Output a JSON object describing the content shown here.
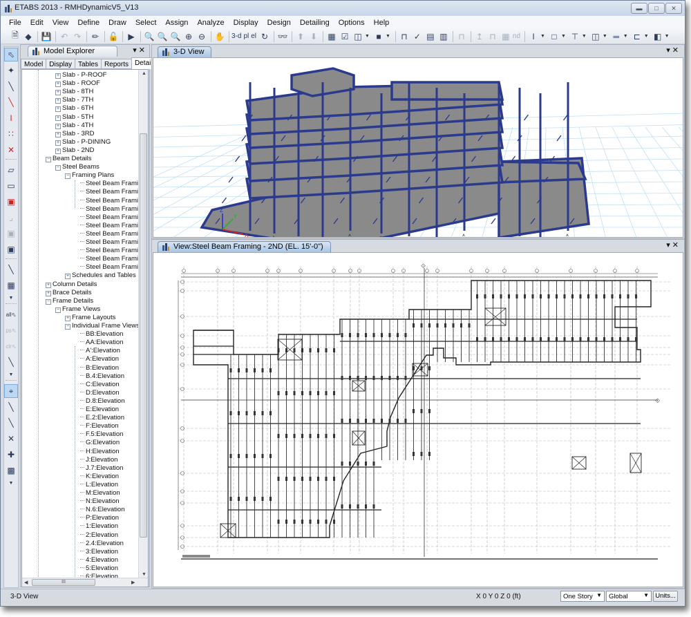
{
  "window": {
    "title": "ETABS 2013  - RMHDynamicV5_V13",
    "controls": [
      "minimize",
      "maximize",
      "close"
    ]
  },
  "menu": [
    "File",
    "Edit",
    "View",
    "Define",
    "Draw",
    "Select",
    "Assign",
    "Analyze",
    "Display",
    "Design",
    "Detailing",
    "Options",
    "Help"
  ],
  "toolbar": {
    "text_buttons": {
      "view_3d": "3-d",
      "plan": "pl",
      "elev": "el",
      "nd": "nd"
    }
  },
  "explorer": {
    "title": "Model Explorer",
    "tabs": [
      "Model",
      "Display",
      "Tables",
      "Reports",
      "Detailing"
    ],
    "active_tab": "Detailing",
    "tree": [
      {
        "label": "Slab - P-ROOF",
        "level": 3,
        "expander": "+"
      },
      {
        "label": "Slab - ROOF",
        "level": 3,
        "expander": "+"
      },
      {
        "label": "Slab - 8TH",
        "level": 3,
        "expander": "+"
      },
      {
        "label": "Slab - 7TH",
        "level": 3,
        "expander": "+"
      },
      {
        "label": "Slab - 6TH",
        "level": 3,
        "expander": "+"
      },
      {
        "label": "Slab - 5TH",
        "level": 3,
        "expander": "+"
      },
      {
        "label": "Slab - 4TH",
        "level": 3,
        "expander": "+"
      },
      {
        "label": "Slab - 3RD",
        "level": 3,
        "expander": "+"
      },
      {
        "label": "Slab - P-DINING",
        "level": 3,
        "expander": "+"
      },
      {
        "label": "Slab - 2ND",
        "level": 3,
        "expander": "+"
      },
      {
        "label": "Beam Details",
        "level": 1,
        "expander": "-"
      },
      {
        "label": "Steel Beams",
        "level": 2,
        "expander": "-"
      },
      {
        "label": "Framing Plans",
        "level": 3,
        "expander": "-"
      },
      {
        "label": "Steel Beam Framing -",
        "level": 4,
        "expander": ""
      },
      {
        "label": "Steel Beam Framing -",
        "level": 4,
        "expander": ""
      },
      {
        "label": "Steel Beam Framing -",
        "level": 4,
        "expander": ""
      },
      {
        "label": "Steel Beam Framing -",
        "level": 4,
        "expander": ""
      },
      {
        "label": "Steel Beam Framing -",
        "level": 4,
        "expander": ""
      },
      {
        "label": "Steel Beam Framing -",
        "level": 4,
        "expander": ""
      },
      {
        "label": "Steel Beam Framing -",
        "level": 4,
        "expander": ""
      },
      {
        "label": "Steel Beam Framing -",
        "level": 4,
        "expander": ""
      },
      {
        "label": "Steel Beam Framing -",
        "level": 4,
        "expander": ""
      },
      {
        "label": "Steel Beam Framing -",
        "level": 4,
        "expander": ""
      },
      {
        "label": "Steel Beam Framing -",
        "level": 4,
        "expander": ""
      },
      {
        "label": "Schedules and Tables",
        "level": 3,
        "expander": "+"
      },
      {
        "label": "Column Details",
        "level": 1,
        "expander": "+"
      },
      {
        "label": "Brace Details",
        "level": 1,
        "expander": "+"
      },
      {
        "label": "Frame Details",
        "level": 1,
        "expander": "-"
      },
      {
        "label": "Frame Views",
        "level": 2,
        "expander": "-"
      },
      {
        "label": "Frame Layouts",
        "level": 3,
        "expander": "+"
      },
      {
        "label": "Individual Frame Views",
        "level": 3,
        "expander": "-"
      },
      {
        "label": "BB:Elevation",
        "level": 4,
        "expander": ""
      },
      {
        "label": "AA:Elevation",
        "level": 4,
        "expander": ""
      },
      {
        "label": "A':Elevation",
        "level": 4,
        "expander": ""
      },
      {
        "label": "A:Elevation",
        "level": 4,
        "expander": ""
      },
      {
        "label": "B:Elevation",
        "level": 4,
        "expander": ""
      },
      {
        "label": "B.4:Elevation",
        "level": 4,
        "expander": ""
      },
      {
        "label": "C:Elevation",
        "level": 4,
        "expander": ""
      },
      {
        "label": "D:Elevation",
        "level": 4,
        "expander": ""
      },
      {
        "label": "D.8:Elevation",
        "level": 4,
        "expander": ""
      },
      {
        "label": "E:Elevation",
        "level": 4,
        "expander": ""
      },
      {
        "label": "E.2:Elevation",
        "level": 4,
        "expander": ""
      },
      {
        "label": "F:Elevation",
        "level": 4,
        "expander": ""
      },
      {
        "label": "F.5:Elevation",
        "level": 4,
        "expander": ""
      },
      {
        "label": "G:Elevation",
        "level": 4,
        "expander": ""
      },
      {
        "label": "H:Elevation",
        "level": 4,
        "expander": ""
      },
      {
        "label": "J:Elevation",
        "level": 4,
        "expander": ""
      },
      {
        "label": "J.7:Elevation",
        "level": 4,
        "expander": ""
      },
      {
        "label": "K:Elevation",
        "level": 4,
        "expander": ""
      },
      {
        "label": "L:Elevation",
        "level": 4,
        "expander": ""
      },
      {
        "label": "M:Elevation",
        "level": 4,
        "expander": ""
      },
      {
        "label": "N:Elevation",
        "level": 4,
        "expander": ""
      },
      {
        "label": "N.6:Elevation",
        "level": 4,
        "expander": ""
      },
      {
        "label": "P:Elevation",
        "level": 4,
        "expander": ""
      },
      {
        "label": "1:Elevation",
        "level": 4,
        "expander": ""
      },
      {
        "label": "2:Elevation",
        "level": 4,
        "expander": ""
      },
      {
        "label": "2.4:Elevation",
        "level": 4,
        "expander": ""
      },
      {
        "label": "3:Elevation",
        "level": 4,
        "expander": ""
      },
      {
        "label": "4:Elevation",
        "level": 4,
        "expander": ""
      },
      {
        "label": "5:Elevation",
        "level": 4,
        "expander": ""
      },
      {
        "label": "6:Elevation",
        "level": 4,
        "expander": ""
      }
    ],
    "hscroll_grip": "III"
  },
  "views": {
    "top": {
      "tab_label": "3-D View"
    },
    "bottom": {
      "tab_label": "View:Steel Beam Framing - 2ND (EL. 15'-0\")"
    }
  },
  "axis_labels": {
    "x": "X",
    "y": "Y",
    "z": "Z"
  },
  "colors": {
    "frame_blue": "#2b3a8c",
    "slab_gray": "#8a8a8a",
    "grid_blue": "#bfe0f5"
  },
  "status": {
    "view_name": "3-D View",
    "coordinates": "X 0  Y 0  Z 0 (ft)",
    "story_option": "One Story",
    "coord_system": "Global",
    "units_button": "Units..."
  }
}
